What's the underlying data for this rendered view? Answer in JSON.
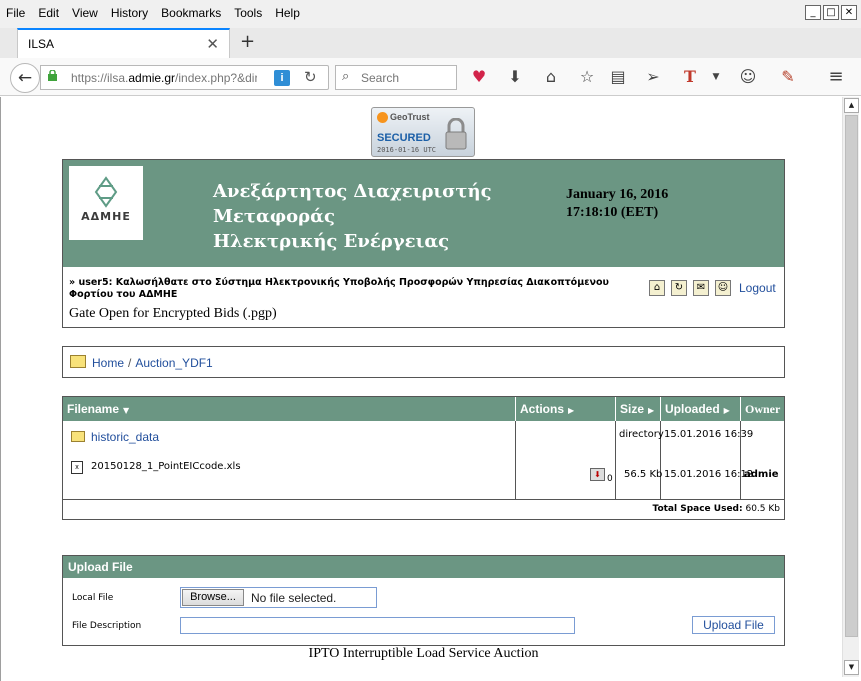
{
  "browser": {
    "menus": [
      "File",
      "Edit",
      "View",
      "History",
      "Bookmarks",
      "Tools",
      "Help"
    ],
    "tab_title": "ILSA",
    "url_prefix": "https://ilsa.",
    "url_domain": "admie.gr",
    "url_suffix": "/index.php?&dire",
    "search_placeholder": "Search"
  },
  "geotrust": {
    "brand": "GeoTrust",
    "secured": "SECURED",
    "date": "2016-01-16 UTC"
  },
  "header": {
    "logo_text": "ΑΔΜΗΕ",
    "title_line1": "Ανεξάρτητος Διαχειριστής Μεταφοράς",
    "title_line2": "Ηλεκτρικής Ενέργειας",
    "date": "January 16, 2016",
    "time": "17:18:10 (EET)",
    "welcome": "» user5: Καλωσήλθατε στο Σύστημα Ηλεκτρονικής Υποβολής Προσφορών Υπηρεσίας Διακοπτόμενου Φορτίου του ΑΔΜΗΕ",
    "gate_status": "Gate Open for Encrypted Bids (.pgp)",
    "logout_label": "Logout"
  },
  "breadcrumb": {
    "home": "Home",
    "separator": "/",
    "current": "Auction_YDF1"
  },
  "file_table": {
    "headers": {
      "filename": "Filename",
      "actions": "Actions",
      "size": "Size",
      "uploaded": "Uploaded",
      "owner": "Owner"
    },
    "rows": [
      {
        "name": "historic_data",
        "type": "folder",
        "size": "directory",
        "uploaded": "15.01.2016 16:39",
        "owner": "",
        "downloads": ""
      },
      {
        "name": "20150128_1_PointEICcode.xls",
        "type": "file",
        "size": "56.5 Kb",
        "uploaded": "15.01.2016 16:12",
        "owner": "admie",
        "downloads": "0"
      }
    ],
    "total_label": "Total Space Used:",
    "total_value": "60.5 Kb"
  },
  "upload": {
    "title": "Upload File",
    "local_file_label": "Local File",
    "browse_label": "Browse...",
    "file_status": "No file selected.",
    "description_label": "File Description",
    "description_value": "",
    "submit_label": "Upload File"
  },
  "footer": "IPTO Interruptible Load Service Auction",
  "colors": {
    "band": "#6b9683",
    "link": "#224f9c"
  }
}
